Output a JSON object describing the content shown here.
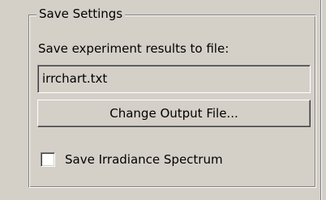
{
  "save_settings": {
    "title": "Save Settings",
    "file_prompt": "Save experiment results to file:",
    "output_file": "irrchart.txt",
    "change_button_label": "Change Output File...",
    "save_spectrum": {
      "label": "Save Irradiance Spectrum",
      "checked": false
    }
  }
}
